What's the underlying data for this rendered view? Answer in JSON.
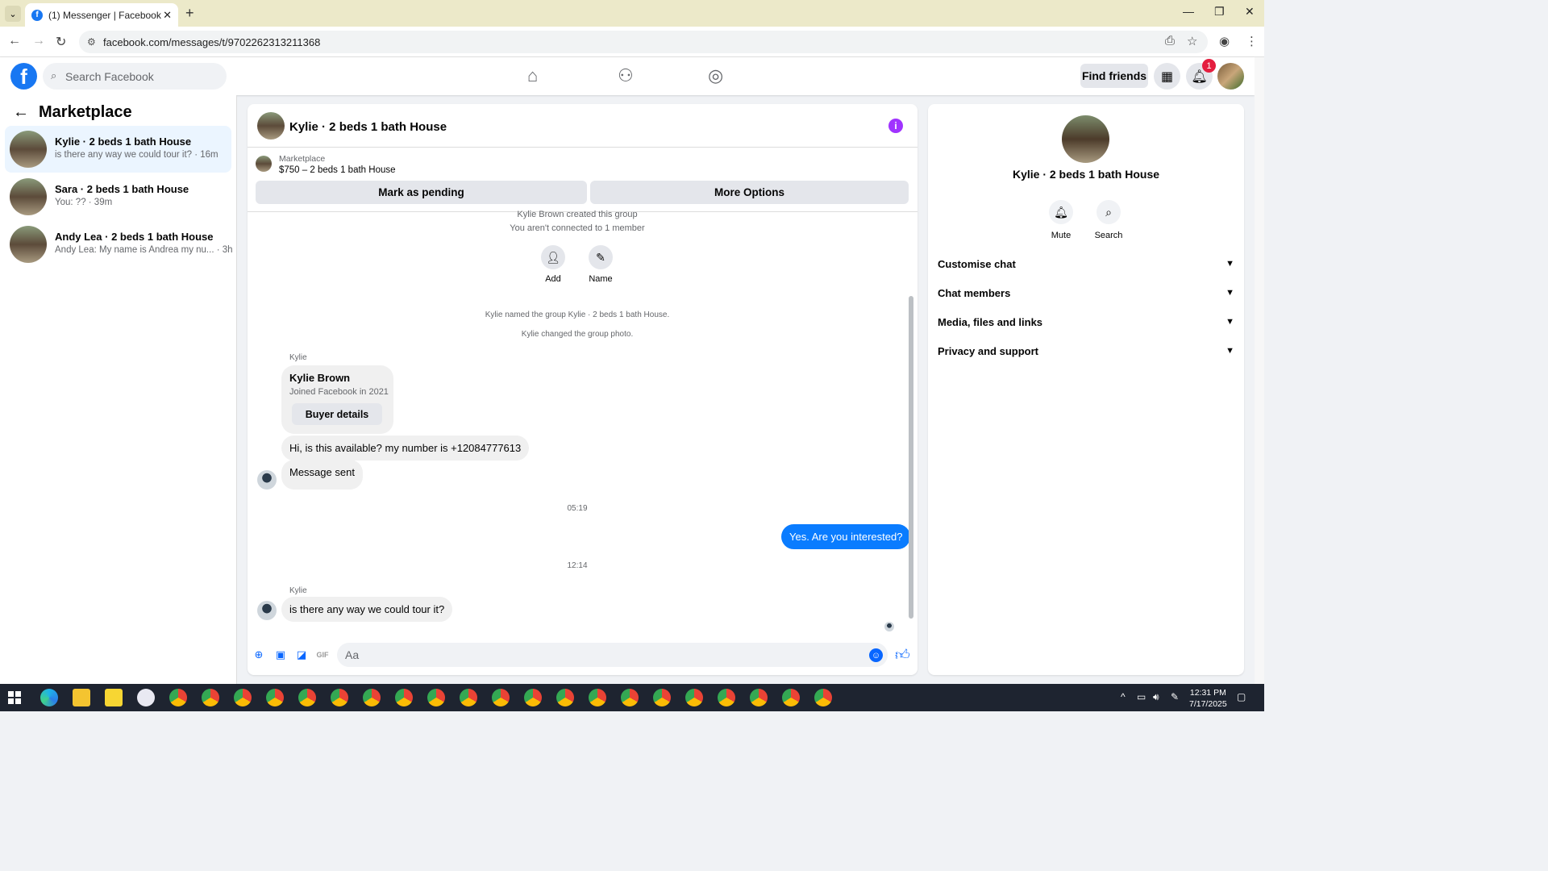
{
  "browser": {
    "tab_title": "(1) Messenger | Facebook",
    "url": "facebook.com/messages/t/9702262313211368"
  },
  "fb_header": {
    "search_placeholder": "Search Facebook",
    "find_friends": "Find friends",
    "notification_count": "1"
  },
  "left_panel": {
    "title": "Marketplace",
    "conversations": [
      {
        "name": "Kylie · 2 beds 1 bath House",
        "preview": "is there any way we could tour it? · 16m"
      },
      {
        "name": "Sara · 2 beds 1 bath House",
        "preview": "You: ?? · 39m"
      },
      {
        "name": "Andy Lea · 2 beds 1 bath House",
        "preview": "Andy Lea: My name is Andrea my nu... · 3h"
      }
    ]
  },
  "chat": {
    "title": "Kylie · 2 beds 1 bath House",
    "marketplace_label": "Marketplace",
    "listing": "$750 – 2 beds 1 bath House",
    "mark_pending": "Mark as pending",
    "more_options": "More Options",
    "created_group": "Kylie Brown created this group",
    "not_connected": "You aren't connected to 1 member",
    "add_label": "Add",
    "name_label": "Name",
    "named_group": "Kylie named the group Kylie · 2 beds 1 bath House.",
    "changed_photo": "Kylie changed the group photo.",
    "sender1": "Kylie",
    "card_name": "Kylie Brown",
    "card_joined": "Joined Facebook in 2021",
    "card_button": "Buyer details",
    "msg1": "Hi, is this available? my number is +12084777613",
    "msg2": "Message sent",
    "time1": "05:19",
    "my_msg": "Yes. Are you interested?",
    "time2": "12:14",
    "sender2": "Kylie",
    "msg3": "is there any way we could tour it?",
    "composer_placeholder": "Aa"
  },
  "right_panel": {
    "title": "Kylie · 2 beds 1 bath House",
    "mute": "Mute",
    "search": "Search",
    "rows": [
      "Customise chat",
      "Chat members",
      "Media, files and links",
      "Privacy and support"
    ]
  },
  "taskbar": {
    "time": "12:31 PM",
    "date": "7/17/2025"
  }
}
